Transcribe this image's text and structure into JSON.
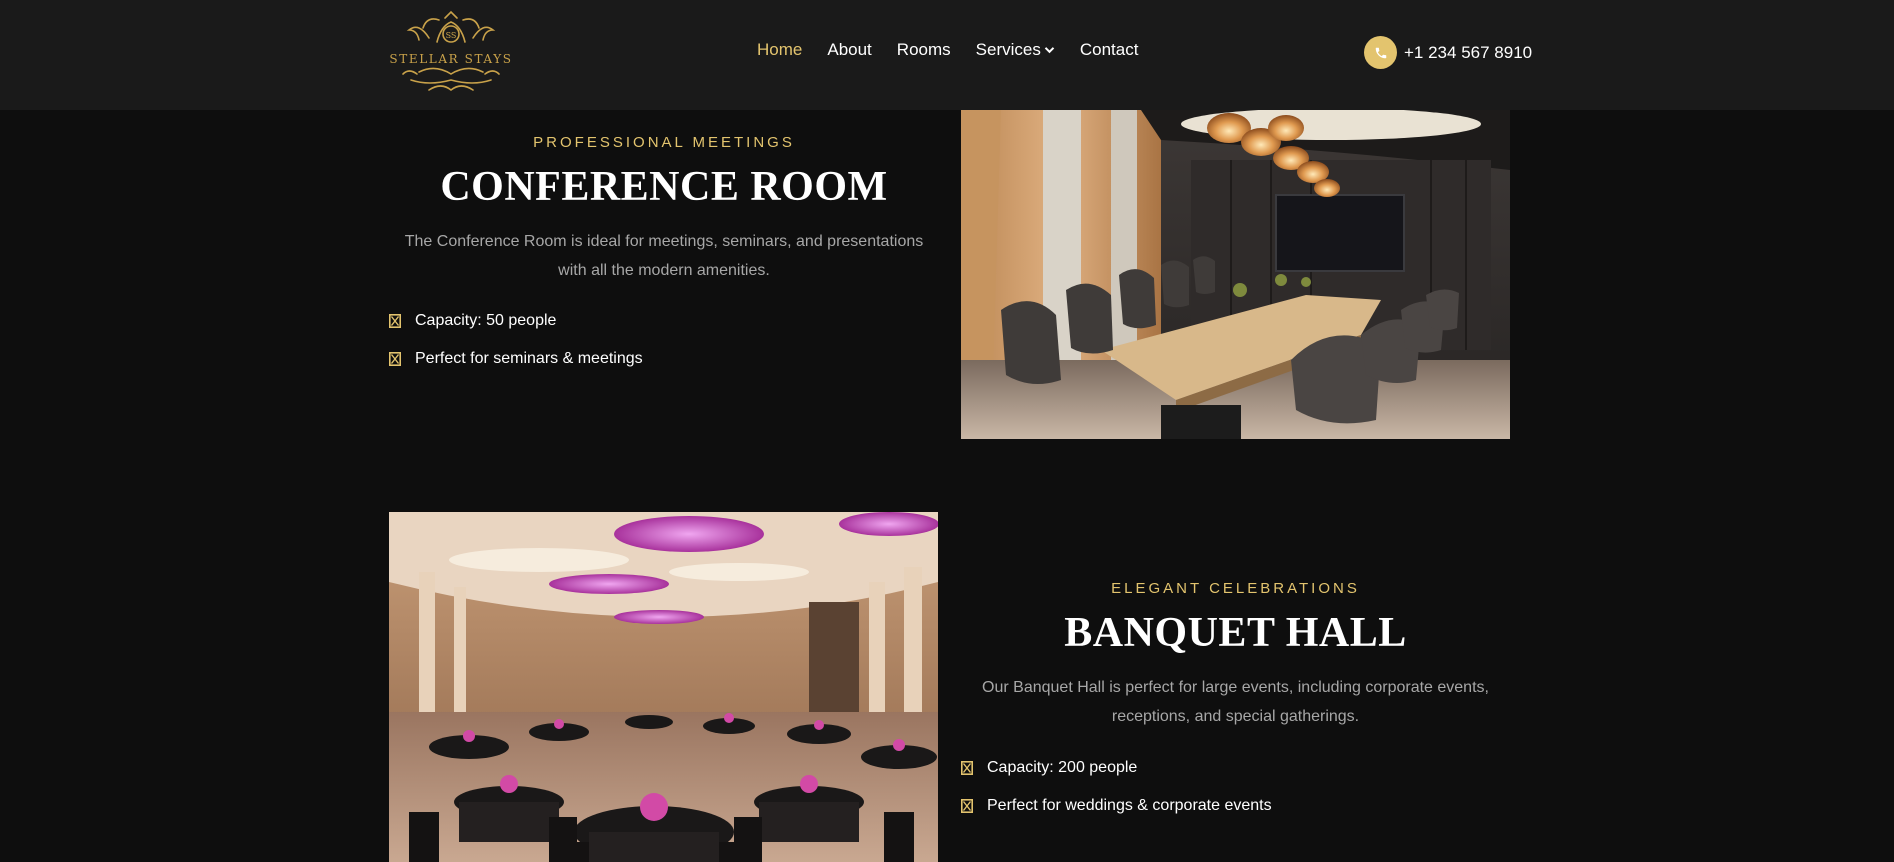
{
  "header": {
    "logo_text": "STELLAR STAYS",
    "logo_monogram": "SS",
    "nav": [
      {
        "label": "Home",
        "active": true
      },
      {
        "label": "About",
        "active": false
      },
      {
        "label": "Rooms",
        "active": false
      },
      {
        "label": "Services",
        "active": false,
        "has_dropdown": true
      },
      {
        "label": "Contact",
        "active": false
      }
    ],
    "phone": "+1 234 567 8910",
    "phone_icon": "phone-icon"
  },
  "conference": {
    "eyebrow": "PROFESSIONAL MEETINGS",
    "title": "CONFERENCE ROOM",
    "description": "The Conference Room is ideal for meetings, seminars, and presentations with all the modern amenities.",
    "features": [
      "Capacity: 50 people",
      "Perfect for seminars & meetings"
    ],
    "image": "conference-room-photo"
  },
  "banquet": {
    "eyebrow": "ELEGANT CELEBRATIONS",
    "title": "BANQUET HALL",
    "description": "Our Banquet Hall is perfect for large events, including corporate events, receptions, and special gatherings.",
    "features": [
      "Capacity: 200 people",
      "Perfect for weddings & corporate events"
    ],
    "image": "banquet-hall-photo"
  },
  "colors": {
    "accent": "#e3c46e",
    "background": "#0e0e0e",
    "header": "#1a1a1a",
    "muted_text": "#a7a7a7"
  }
}
